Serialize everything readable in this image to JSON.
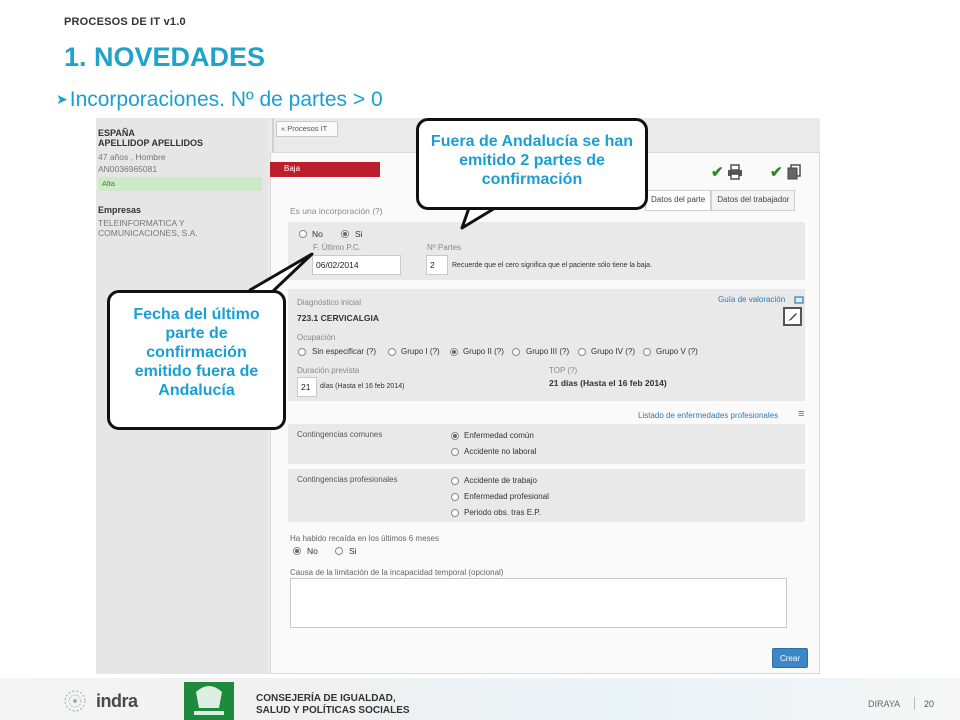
{
  "slide": {
    "header": "PROCESOS DE IT v1.0",
    "title": "1. NOVEDADES",
    "bullet": "Incorporaciones. Nº de partes > 0"
  },
  "patient": {
    "country": "ESPAÑA",
    "name": "APELLIDOP APELLIDOS",
    "age": "47 años , Hombre",
    "code": "AN0036965081",
    "status": "Alta",
    "empresas_label": "Empresas",
    "company": "TELEINFORMATICA Y COMUNICACIONES, S.A."
  },
  "nav": {
    "back_label": "« Procesos IT"
  },
  "form": {
    "tag": "Baja",
    "tabs": [
      "Datos del parte",
      "Datos del trabajador"
    ],
    "incorporacion_question": "Es una incorporación (?)",
    "no_label": "No",
    "si_label": "Si",
    "fecha_label": "F. Último P.C.",
    "fecha_value": "06/02/2014",
    "npartes_label": "Nº Partes",
    "npartes_value": "2",
    "npartes_hint": "Recuerde que el cero significa que el paciente sólo tiene la baja.",
    "diag_label": "Diagnóstico inicial",
    "diag_value": "723.1 CERVICALGIA",
    "guia_link": "Guía de valoración",
    "ocupacion_label": "Ocupación",
    "ocupacion_options": [
      "Sin especificar (?)",
      "Grupo I (?)",
      "Grupo II (?)",
      "Grupo III (?)",
      "Grupo IV (?)",
      "Grupo V (?)"
    ],
    "duracion_label": "Duración prevista",
    "duracion_value": "21",
    "duracion_suffix": "días (Hasta el 16 feb 2014)",
    "top_label": "TOP (?)",
    "top_value": "21 días (Hasta el 16 feb 2014)",
    "listado_link": "Listado de enfermedades profesionales",
    "comunes_label": "Contingencias comunes",
    "comunes_options": [
      "Enfermedad común",
      "Accidente no laboral"
    ],
    "profesionales_label": "Contingencias profesionales",
    "profesionales_options": [
      "Accidente de trabajo",
      "Enfermedad profesional",
      "Periodo obs. tras E.P."
    ],
    "recaida_question": "Ha habido recaída en los últimos 6 meses",
    "recaida_no": "No",
    "recaida_si": "Si",
    "causa_label": "Causa de la limitación de la incapacidad temporal (opcional)",
    "crear_label": "Crear"
  },
  "callouts": {
    "top": "Fuera de Andalucía se han emitido 2 partes de confirmación",
    "left": "Fecha del último parte de confirmación emitido fuera de Andalucía"
  },
  "footer": {
    "indra": "indra",
    "consejeria_line1": "CONSEJERÍA DE IGUALDAD,",
    "consejeria_line2": "SALUD Y POLÍTICAS SOCIALES",
    "diraya": "DIRAYA",
    "page": "20"
  },
  "colors": {
    "accent": "#1ea3c9",
    "baja": "#bc1e2c",
    "alta": "#cde9c6",
    "button": "#3b87c8",
    "link": "#2a7ab8"
  }
}
